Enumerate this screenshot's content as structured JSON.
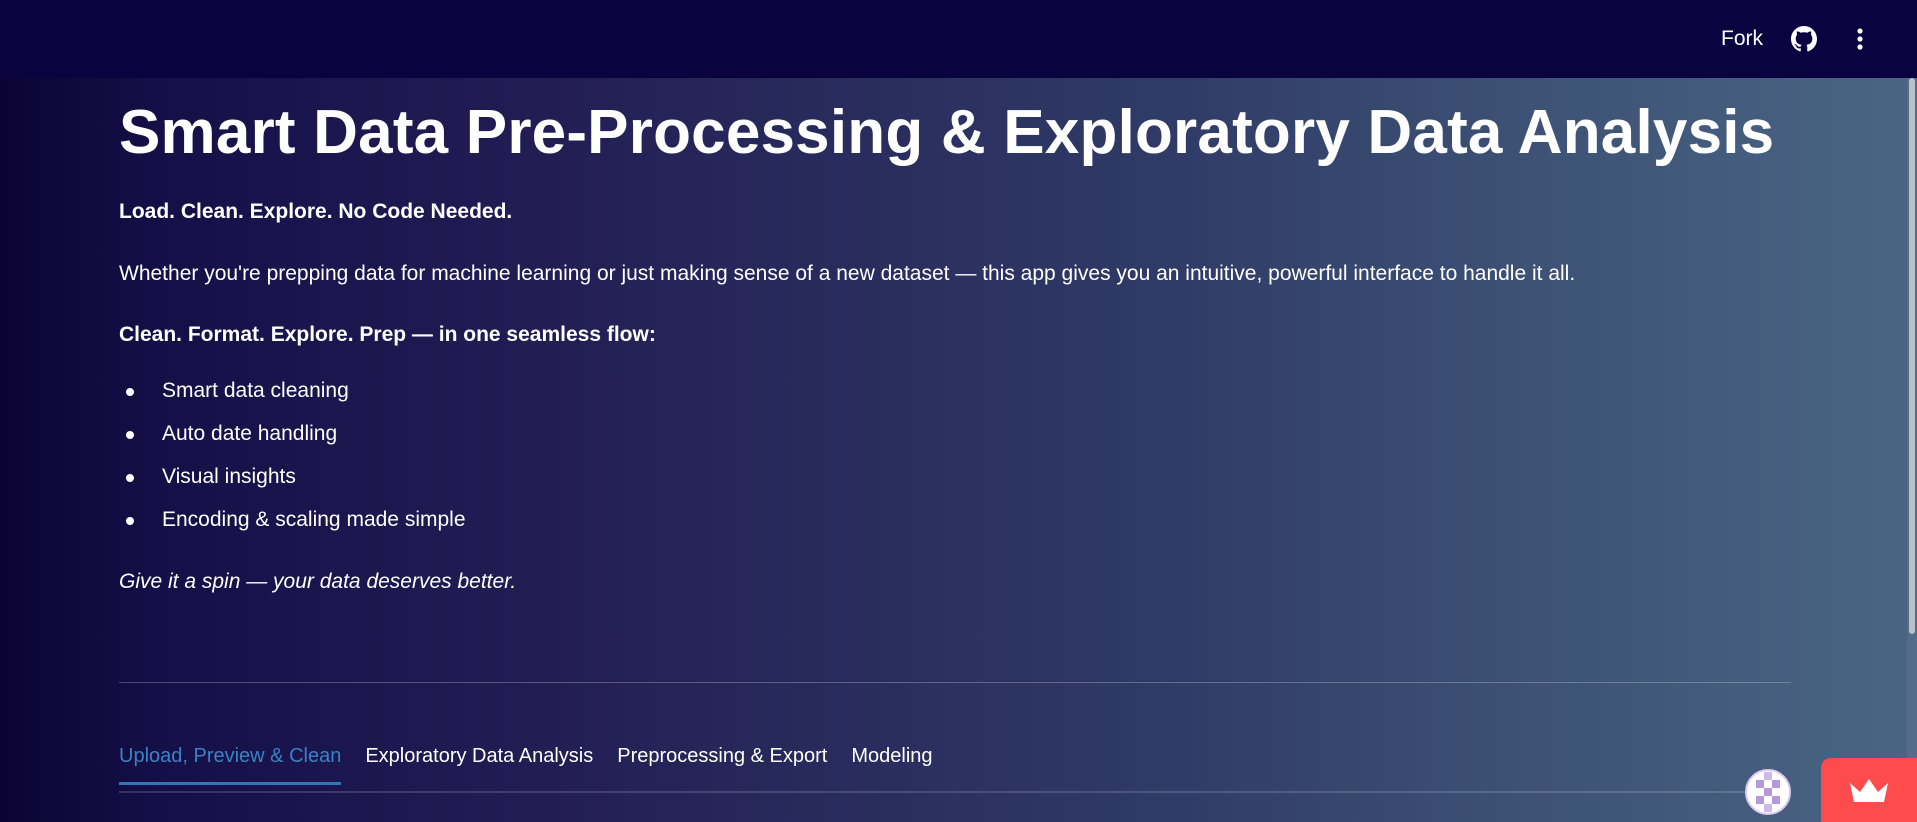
{
  "header": {
    "fork_label": "Fork",
    "icons": [
      "github-icon",
      "kebab-menu-icon"
    ]
  },
  "main": {
    "title": "Smart Data Pre-Processing & Exploratory Data Analysis",
    "tagline": "Load. Clean. Explore. No Code Needed.",
    "intro": "Whether you're prepping data for machine learning or just making sense of a new dataset — this app gives you an intuitive, powerful interface to handle it all.",
    "flow_heading": "Clean. Format. Explore. Prep — in one seamless flow:",
    "features": [
      "Smart data cleaning",
      "Auto date handling",
      "Visual insights",
      "Encoding & scaling made simple"
    ],
    "closing": "Give it a spin — your data deserves better."
  },
  "tabs": [
    {
      "label": "Upload, Preview & Clean",
      "active": true
    },
    {
      "label": "Exploratory Data Analysis",
      "active": false
    },
    {
      "label": "Preprocessing & Export",
      "active": false
    },
    {
      "label": "Modeling",
      "active": false
    }
  ],
  "colors": {
    "topbar": "#0b0340",
    "active_tab": "#3b82c4",
    "badge": "#ff4b4b"
  }
}
